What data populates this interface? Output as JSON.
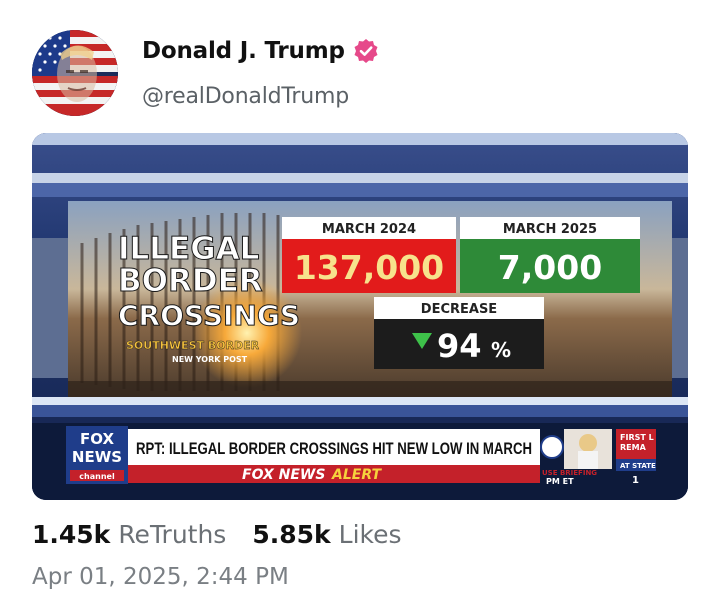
{
  "post": {
    "display_name": "Donald J. Trump",
    "handle": "@realDonaldTrump",
    "verified_icon": "verified-badge-icon",
    "accent_color": "#e6498a",
    "avatar_icon": "flag-portrait-avatar"
  },
  "media": {
    "graphic": {
      "title_lines": [
        "ILLEGAL",
        "BORDER",
        "CROSSINGS"
      ],
      "subtitle": "SOUTHWEST BORDER",
      "source": "NEW YORK POST",
      "box1_label": "MARCH 2024",
      "box1_value": "137,000",
      "box2_label": "MARCH 2025",
      "box2_value": "7,000",
      "box3_label": "DECREASE",
      "box3_value": "94",
      "box3_unit": "%"
    },
    "ticker": {
      "logo_top": "FOX",
      "logo_mid": "NEWS",
      "logo_bottom": "channel",
      "headline": "RPT: ILLEGAL BORDER CROSSINGS HIT NEW LOW IN MARCH",
      "alert_brand": "FOX NEWS",
      "alert_word": "ALERT",
      "side_caption": "USE BRIEFING",
      "side_time": "PM ET",
      "right_line1": "FIRST L",
      "right_line2": "REMA",
      "right_line3": "AT STATE",
      "right_num": "1"
    }
  },
  "stats": {
    "retruths_count": "1.45k",
    "retruths_label": "ReTruths",
    "likes_count": "5.85k",
    "likes_label": "Likes"
  },
  "timestamp": "Apr 01, 2025, 2:44 PM"
}
